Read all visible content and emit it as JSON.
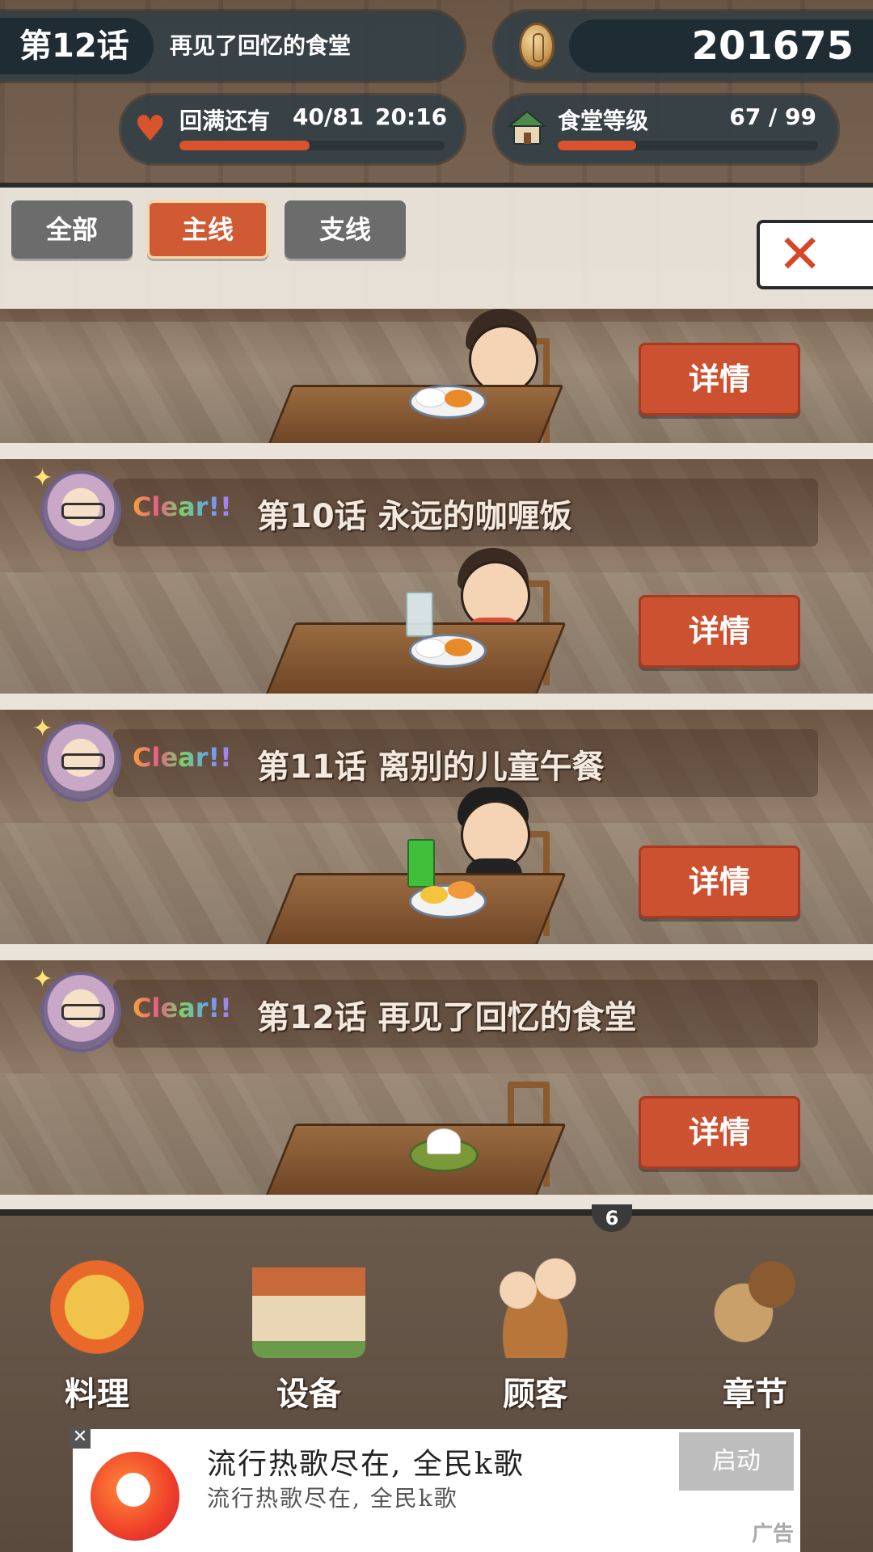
{
  "hud": {
    "chapter_number": "第12话",
    "chapter_title": "再见了回忆的食堂",
    "coins": "201675",
    "stamina": {
      "label": "回满还有",
      "count": "40/81",
      "timer": "20:16",
      "fill_fraction": 0.49
    },
    "restaurant": {
      "label": "食堂等级",
      "level": "67 / 99",
      "fill_fraction": 0.3
    }
  },
  "filters": {
    "all": "全部",
    "main": "主线",
    "side": "支线",
    "active": "主线"
  },
  "close_icon": "✕",
  "episodes": [
    {
      "clear": "",
      "title": "",
      "detail": "详情"
    },
    {
      "clear": "Clear!!",
      "title": "第10话  永远的咖喱饭",
      "detail": "详情"
    },
    {
      "clear": "Clear!!",
      "title": "第11话  离别的儿童午餐",
      "detail": "详情"
    },
    {
      "clear": "Clear!!",
      "title": "第12话  再见了回忆的食堂",
      "detail": "详情"
    }
  ],
  "menu": {
    "badge": "6",
    "cooking": "料理",
    "equipment": "设备",
    "customers": "顾客",
    "chapters": "章节"
  },
  "ad": {
    "close": "✕",
    "line1": "流行热歌尽在, 全民k歌",
    "line2": "流行热歌尽在, 全民k歌",
    "button": "启动",
    "tag": "广告"
  },
  "colors": {
    "accent": "#d05a33",
    "hud": "#303e46"
  }
}
